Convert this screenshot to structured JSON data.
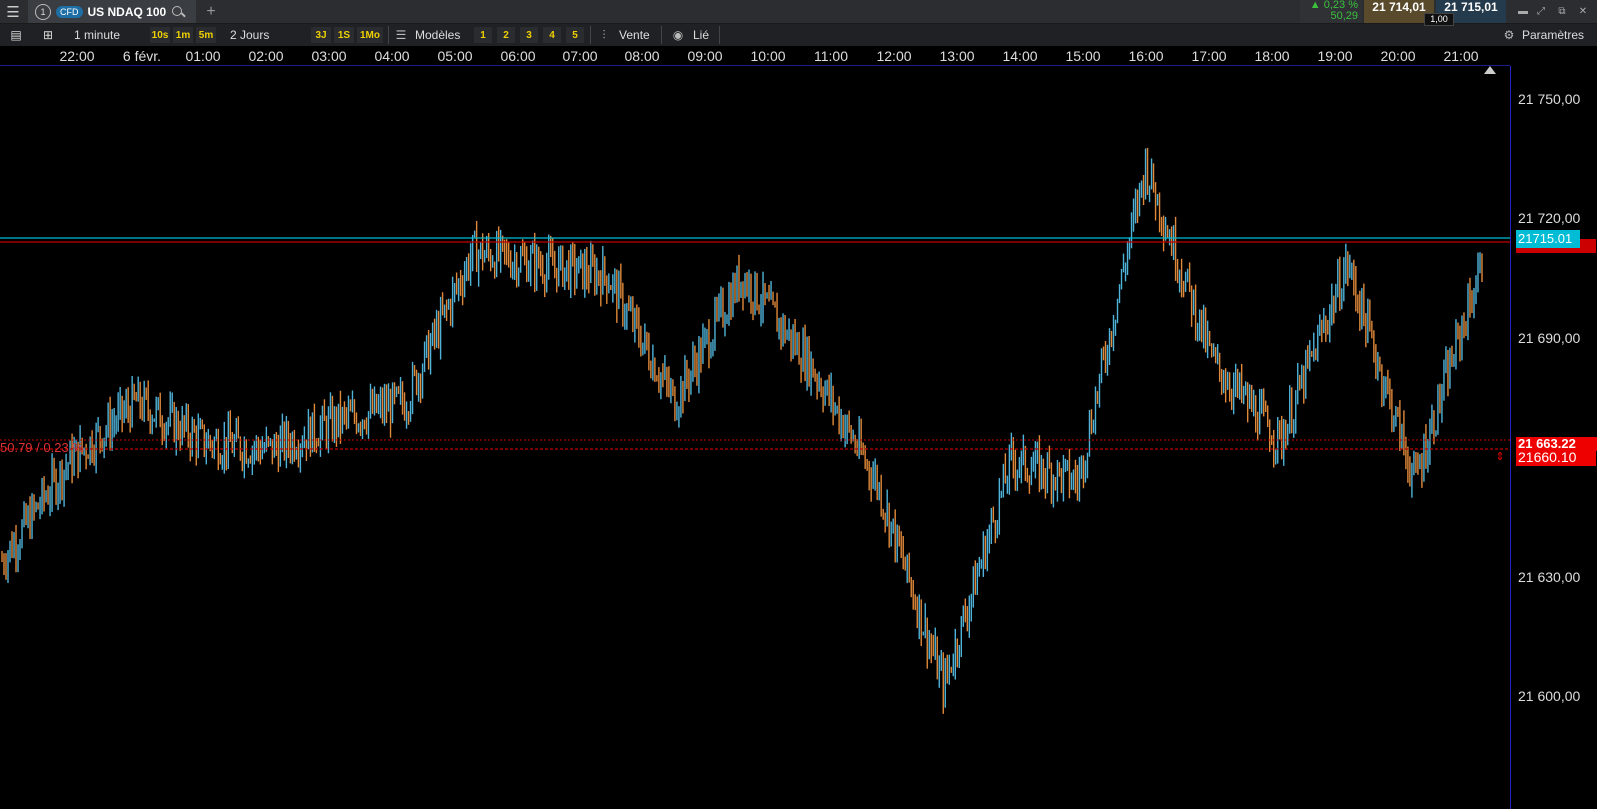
{
  "header": {
    "tab_number": "1",
    "instrument_type": "CFD",
    "instrument_name": "US NDAQ 100",
    "change_percent": "▲ 0,23 %",
    "change_value": "50,29",
    "bid": "21 714,01",
    "ask": "21 715,01",
    "quantity": "1,00"
  },
  "toolbar": {
    "interval": "1 minute",
    "quick_intervals": [
      "10s",
      "1m",
      "5m"
    ],
    "range": "2 Jours",
    "quick_ranges": [
      "3J",
      "1S",
      "1Mo"
    ],
    "templates": "Modèles",
    "slots": [
      "1",
      "2",
      "3",
      "4",
      "5"
    ],
    "side": "Vente",
    "linked": "Lié",
    "settings": "Paramètres"
  },
  "time_axis": [
    "22:00",
    "6 févr.",
    "01:00",
    "02:00",
    "03:00",
    "04:00",
    "05:00",
    "06:00",
    "07:00",
    "08:00",
    "09:00",
    "10:00",
    "11:00",
    "12:00",
    "13:00",
    "14:00",
    "15:00",
    "16:00",
    "17:00",
    "18:00",
    "19:00",
    "20:00",
    "21:00"
  ],
  "price_axis": [
    "21 750,00",
    "21 720,00",
    "21 690,00",
    "21 660,00",
    "21 630,00",
    "21 600,00"
  ],
  "markers": {
    "cyan_price": "21715.01",
    "red_level_top": "21 663,22",
    "red_level_bottom": "21660.10",
    "red_info": "50.79 / 0.23 %"
  },
  "colors": {
    "up_candle": "#4fb3d9",
    "down_candle": "#e0893a",
    "level_red": "#c00000",
    "level_cyan": "#00bcd4"
  },
  "chart_data": {
    "type": "line",
    "ylim": [
      21585,
      21760
    ],
    "x": [
      "22:00",
      "00:00",
      "01:00",
      "02:00",
      "03:00",
      "04:00",
      "05:00",
      "06:00",
      "07:00",
      "08:00",
      "09:00",
      "10:00",
      "11:00",
      "12:00",
      "13:00",
      "14:00",
      "15:00",
      "16:00",
      "17:00",
      "18:00",
      "19:00",
      "20:00",
      "21:00"
    ],
    "series": [
      {
        "values": [
          21640,
          21665,
          21680,
          21670,
          21668,
          21675,
          21680,
          21718,
          21715,
          21712,
          21680,
          21712,
          21690,
          21660,
          21608,
          21665,
          21660,
          21740,
          21690,
          21670,
          21715,
          21660,
          21715
        ]
      }
    ]
  }
}
